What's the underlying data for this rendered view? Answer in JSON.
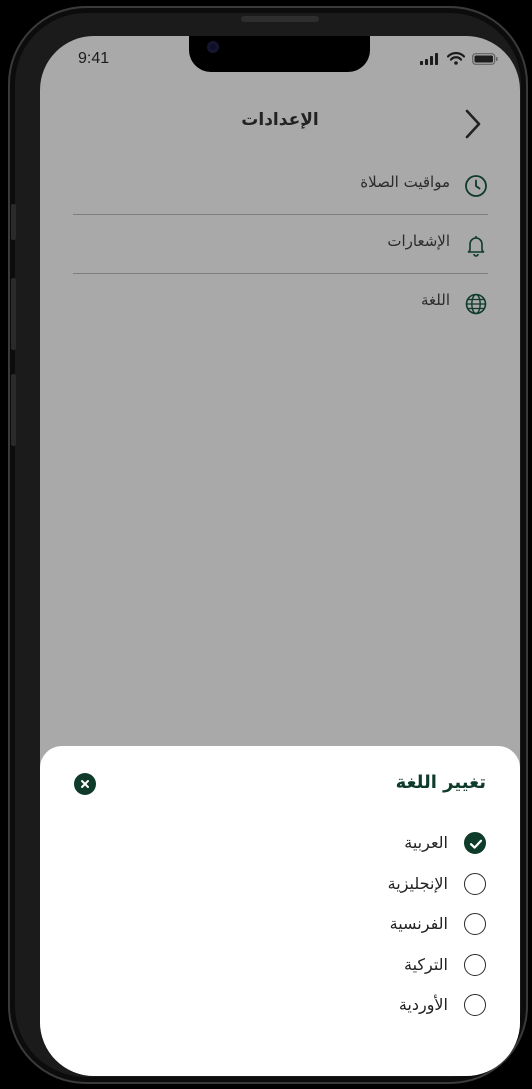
{
  "status_bar": {
    "time": "9:41"
  },
  "header": {
    "title": "الإعدادات",
    "back_icon": "chevron-back-icon"
  },
  "settings": {
    "items": [
      {
        "label": "مواقيت الصلاة",
        "icon": "clock-icon"
      },
      {
        "label": "الإشعارات",
        "icon": "bell-icon"
      },
      {
        "label": "اللغة",
        "icon": "globe-icon"
      }
    ]
  },
  "language_sheet": {
    "title": "تغيير اللغة",
    "close_icon": "close-icon",
    "accent_color": "#0f3b2a",
    "selected": "العربية",
    "options": [
      {
        "label": "العربية",
        "selected": true
      },
      {
        "label": "الإنجليزية",
        "selected": false
      },
      {
        "label": "الفرنسية",
        "selected": false
      },
      {
        "label": "التركية",
        "selected": false
      },
      {
        "label": "الأوردية",
        "selected": false
      }
    ]
  }
}
